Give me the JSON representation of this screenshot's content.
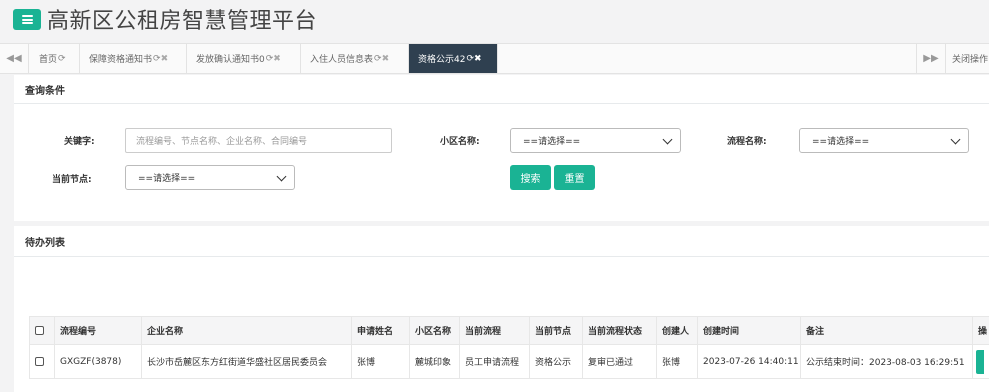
{
  "header": {
    "title": "高新区公租房智慧管理平台"
  },
  "tabs": {
    "items": [
      {
        "label": "首页"
      },
      {
        "label": "保障资格通知书"
      },
      {
        "label": "发放确认通知书0"
      },
      {
        "label": "入住人员信息表"
      },
      {
        "label": "资格公示42"
      }
    ],
    "close_ops_label": "关闭操作"
  },
  "query": {
    "title": "查询条件",
    "keyword_label": "关键字:",
    "keyword_placeholder": "流程编号、节点名称、企业名称、合同编号",
    "community_label": "小区名称:",
    "community_value": "==请选择==",
    "process_label": "流程名称:",
    "process_value": "==请选择==",
    "node_label": "当前节点:",
    "node_value": "==请选择==",
    "search_label": "搜索",
    "reset_label": "重置"
  },
  "list": {
    "title": "待办列表",
    "columns": [
      "流程编号",
      "企业名称",
      "申请姓名",
      "小区名称",
      "当前流程",
      "当前节点",
      "当前流程状态",
      "创建人",
      "创建时间",
      "备注",
      "操"
    ],
    "rows": [
      {
        "flow_no": "GXGZF(3878)",
        "company": "长沙市岳麓区东方红街道华盛社区居民委员会",
        "applicant": "张博",
        "community": "麓城印象",
        "current_flow": "员工申请流程",
        "current_node": "资格公示",
        "status": "复审已通过",
        "creator": "张博",
        "created_at": "2023-07-26 14:40:11",
        "remark": "公示结束时间：2023-08-03 16:29:51"
      }
    ]
  },
  "colors": {
    "accent": "#1ab394",
    "active_tab": "#2f4050"
  }
}
